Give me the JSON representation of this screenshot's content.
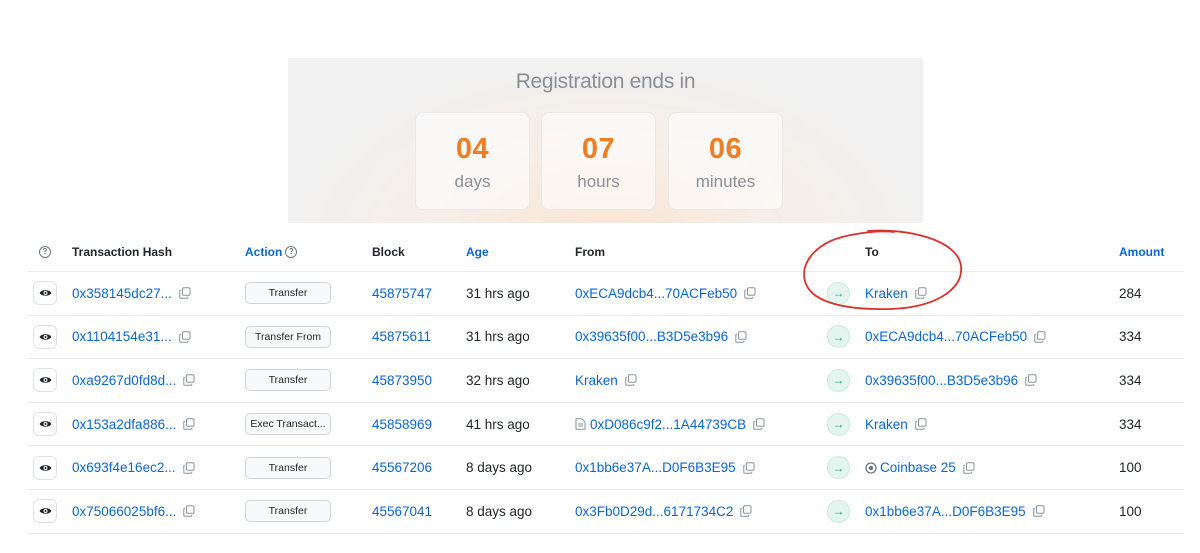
{
  "banner": {
    "title": "Registration ends in",
    "timer": [
      {
        "value": "04",
        "unit": "days"
      },
      {
        "value": "07",
        "unit": "hours"
      },
      {
        "value": "06",
        "unit": "minutes"
      }
    ]
  },
  "table": {
    "headers": {
      "hash": "Transaction Hash",
      "action": "Action",
      "block": "Block",
      "age": "Age",
      "from": "From",
      "to": "To",
      "amount": "Amount"
    },
    "rows": [
      {
        "hash": "0x358145dc27...",
        "action": "Transfer",
        "block": "45875747",
        "age": "31 hrs ago",
        "from": "0xECA9dcb4...70ACFeb50",
        "to": "Kraken",
        "amount": "284"
      },
      {
        "hash": "0x1104154e31...",
        "action": "Transfer From",
        "block": "45875611",
        "age": "31 hrs ago",
        "from": "0x39635f00...B3D5e3b96",
        "to": "0xECA9dcb4...70ACFeb50",
        "amount": "334"
      },
      {
        "hash": "0xa9267d0fd8d...",
        "action": "Transfer",
        "block": "45873950",
        "age": "32 hrs ago",
        "from": "Kraken",
        "to": "0x39635f00...B3D5e3b96",
        "amount": "334"
      },
      {
        "hash": "0x153a2dfa886...",
        "action": "Exec Transact...",
        "block": "45858969",
        "age": "41 hrs ago",
        "from": "0xD086c9f2...1A44739CB",
        "to": "Kraken",
        "amount": "334"
      },
      {
        "hash": "0x693f4e16ec2...",
        "action": "Transfer",
        "block": "45567206",
        "age": "8 days ago",
        "from": "0x1bb6e37A...D0F6B3E95",
        "to": "Coinbase 25",
        "amount": "100"
      },
      {
        "hash": "0x75066025bf6...",
        "action": "Transfer",
        "block": "45567041",
        "age": "8 days ago",
        "from": "0x3Fb0D29d...6171734C2",
        "to": "0x1bb6e37A...D0F6B3E95",
        "amount": "100"
      }
    ]
  },
  "colors": {
    "link": "#0b66d3",
    "timer_value": "#ee7d24",
    "annotation": "#d9312b",
    "arrow_green": "#16a571"
  }
}
